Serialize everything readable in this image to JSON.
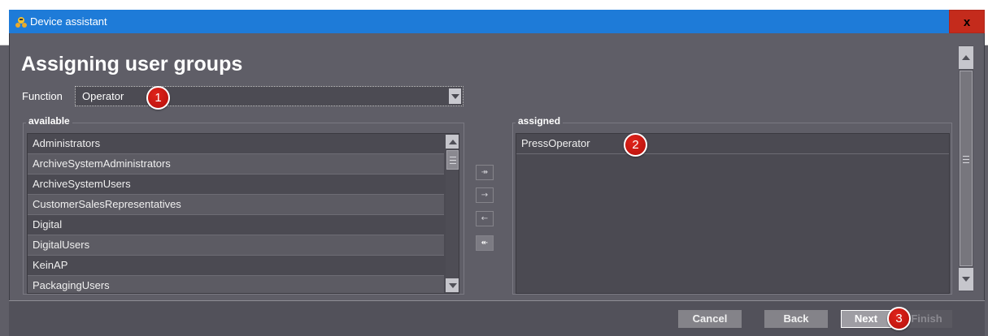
{
  "window": {
    "title": "Device assistant",
    "close_label": "x"
  },
  "page": {
    "title": "Assigning user groups"
  },
  "function_field": {
    "label": "Function",
    "value": "Operator"
  },
  "available": {
    "title": "available",
    "items": [
      {
        "label": "Administrators"
      },
      {
        "label": "ArchiveSystemAdministrators"
      },
      {
        "label": "ArchiveSystemUsers"
      },
      {
        "label": "CustomerSalesRepresentatives"
      },
      {
        "label": "Digital"
      },
      {
        "label": "DigitalUsers"
      },
      {
        "label": "KeinAP"
      },
      {
        "label": "PackagingUsers"
      }
    ]
  },
  "assigned": {
    "title": "assigned",
    "items": [
      {
        "label": "PressOperator"
      }
    ]
  },
  "move_buttons": [
    {
      "icon": "move-all-right-icon",
      "glyph": "↠"
    },
    {
      "icon": "move-right-icon",
      "glyph": "→"
    },
    {
      "icon": "move-left-icon",
      "glyph": "←"
    },
    {
      "icon": "move-all-left-icon",
      "glyph": "↞"
    }
  ],
  "badges": {
    "b1": "1",
    "b2": "2",
    "b3": "3"
  },
  "footer": {
    "cancel": "Cancel",
    "back": "Back",
    "next": "Next",
    "finish": "Finish"
  },
  "colors": {
    "titlebar": "#1e7bd8",
    "close": "#c42b1c",
    "badge": "#d41e16",
    "background": "#5f5e67"
  }
}
